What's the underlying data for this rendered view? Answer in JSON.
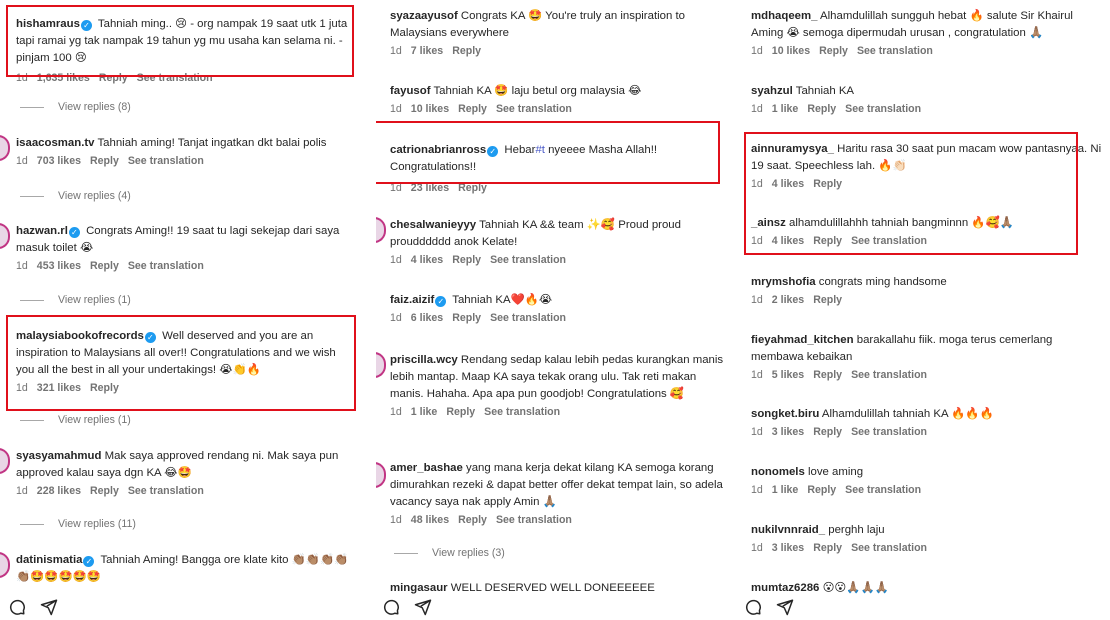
{
  "columns": [
    {
      "comments": [
        {
          "user": "hishamraus",
          "verified": true,
          "text": "Tahniah ming.. 😢 - org nampak 19 saat utk 1 juta tapi ramai yg tak nampak 19 tahun yg mu usaha kan selama ni. - pinjam 100 😢",
          "time": "1d",
          "likes": "1,635 likes",
          "reply": "Reply",
          "translate": "See translation"
        },
        {
          "user": "isaacosman.tv",
          "verified": false,
          "text": "Tahniah aming! Tanjat ingatkan dkt balai polis",
          "time": "1d",
          "likes": "703 likes",
          "reply": "Reply",
          "translate": "See translation"
        },
        {
          "user": "hazwan.rl",
          "verified": true,
          "text": "Congrats Aming!! 19 saat tu lagi sekejap dari saya masuk toilet 😭",
          "time": "1d",
          "likes": "453 likes",
          "reply": "Reply",
          "translate": "See translation"
        },
        {
          "user": "malaysiabookofrecords",
          "verified": true,
          "text": "Well deserved and you are an inspiration to Malaysians all over!! Congratulations and we wish you all the best in all your undertakings! 😭👏🔥",
          "time": "1d",
          "likes": "321 likes",
          "reply": "Reply",
          "translate": ""
        },
        {
          "user": "syasyamahmud",
          "verified": false,
          "text": "Mak saya approved rendang ni. Mak saya pun approved kalau saya dgn KA 😂🤩",
          "time": "1d",
          "likes": "228 likes",
          "reply": "Reply",
          "translate": "See translation"
        },
        {
          "user": "datinismatia",
          "verified": true,
          "text": "Tahniah Aming! Bangga ore klate kito 👏🏽👏🏽👏🏽👏🏽👏🏽🤩🤩🤩🤩🤩",
          "time": "",
          "likes": "",
          "reply": "",
          "translate": ""
        }
      ],
      "replies": [
        "View replies (8)",
        "View replies (4)",
        "View replies (1)",
        "View replies (1)",
        "View replies (11)"
      ]
    },
    {
      "comments": [
        {
          "user": "syazaayusof",
          "verified": false,
          "text": "Congrats KA 🤩 You're truly an inspiration to Malaysians everywhere",
          "time": "1d",
          "likes": "7 likes",
          "reply": "Reply",
          "translate": ""
        },
        {
          "user": "fayusof",
          "verified": false,
          "text": "Tahniah KA 🤩 laju betul org malaysia 😂",
          "time": "1d",
          "likes": "10 likes",
          "reply": "Reply",
          "translate": "See translation"
        },
        {
          "user": "catrionabrianross",
          "verified": true,
          "text_pre": "Hebar",
          "tag": "#t",
          "text_post": " nyeeee Masha Allah!! Congratulations!!",
          "time": "1d",
          "likes": "23 likes",
          "reply": "Reply",
          "translate": ""
        },
        {
          "user": "chesalwanieyyy",
          "verified": false,
          "text": "Tahniah KA && team ✨🥰 Proud proud proudddddd anok Kelate!",
          "time": "1d",
          "likes": "4 likes",
          "reply": "Reply",
          "translate": "See translation"
        },
        {
          "user": "faiz.aizif",
          "verified": true,
          "text": "Tahniah KA❤️🔥😭",
          "time": "1d",
          "likes": "6 likes",
          "reply": "Reply",
          "translate": "See translation"
        },
        {
          "user": "priscilla.wcy",
          "verified": false,
          "text": "Rendang sedap kalau lebih pedas kurangkan manis lebih mantap. Maap KA saya tekak orang ulu. Tak reti makan manis. Hahaha. Apa apa pun goodjob! Congratulations 🥰",
          "time": "1d",
          "likes": "1 like",
          "reply": "Reply",
          "translate": "See translation"
        },
        {
          "user": "amer_bashae",
          "verified": false,
          "text": "yang mana kerja dekat kilang KA semoga korang dimurahkan rezeki & dapat better offer dekat tempat lain, so adela vacancy saya nak apply Amin 🙏🏽",
          "time": "1d",
          "likes": "48 likes",
          "reply": "Reply",
          "translate": "See translation"
        },
        {
          "user": "mingasaur",
          "verified": false,
          "text": "WELL DESERVED WELL DONEEEEEE",
          "time": "",
          "likes": "",
          "reply": "",
          "translate": ""
        }
      ],
      "replies": [
        "View replies (3)"
      ]
    },
    {
      "comments": [
        {
          "user": "mdhaqeem_",
          "verified": false,
          "text": "Alhamdulillah sungguh hebat 🔥 salute Sir Khairul Aming 😭 semoga dipermudah urusan , congratulation 🙏🏽",
          "time": "1d",
          "likes": "10 likes",
          "reply": "Reply",
          "translate": "See translation"
        },
        {
          "user": "syahzul",
          "verified": false,
          "text": "Tahniah KA",
          "time": "1d",
          "likes": "1 like",
          "reply": "Reply",
          "translate": "See translation"
        },
        {
          "user": "ainnuramysya_",
          "verified": false,
          "text": "Haritu rasa 30 saat pun macam wow pantasnyaa. Ni 19 saat. Speechless lah. 🔥👏🏻",
          "time": "1d",
          "likes": "4 likes",
          "reply": "Reply",
          "translate": ""
        },
        {
          "user": "_ainsz",
          "verified": false,
          "text": "alhamdulillahhh tahniah bangminnn 🔥🥰🙏🏽",
          "time": "1d",
          "likes": "4 likes",
          "reply": "Reply",
          "translate": "See translation"
        },
        {
          "user": "mrymshofia",
          "verified": false,
          "text": "congrats ming handsome",
          "time": "1d",
          "likes": "2 likes",
          "reply": "Reply",
          "translate": ""
        },
        {
          "user": "fieyahmad_kitchen",
          "verified": false,
          "text": "barakallahu fiik. moga terus cemerlang membawa kebaikan",
          "time": "1d",
          "likes": "5 likes",
          "reply": "Reply",
          "translate": "See translation"
        },
        {
          "user": "songket.biru",
          "verified": false,
          "text": "Alhamdulillah tahniah KA 🔥🔥🔥",
          "time": "1d",
          "likes": "3 likes",
          "reply": "Reply",
          "translate": "See translation"
        },
        {
          "user": "nonomels",
          "verified": false,
          "text": "love aming",
          "time": "1d",
          "likes": "1 like",
          "reply": "Reply",
          "translate": "See translation"
        },
        {
          "user": "nukilvnnraid_",
          "verified": false,
          "text": "perghh laju",
          "time": "1d",
          "likes": "3 likes",
          "reply": "Reply",
          "translate": "See translation"
        },
        {
          "user": "mumtaz6286",
          "verified": false,
          "text": "😮😮🙏🏽🙏🏽🙏🏽",
          "time": "",
          "likes": "",
          "reply": "",
          "translate": ""
        }
      ],
      "replies": []
    }
  ],
  "colors": {
    "highlight": "#e0101b",
    "verified": "#1d9bf0",
    "meta": "#737373"
  },
  "icons": [
    "comment-icon",
    "share-icon"
  ]
}
